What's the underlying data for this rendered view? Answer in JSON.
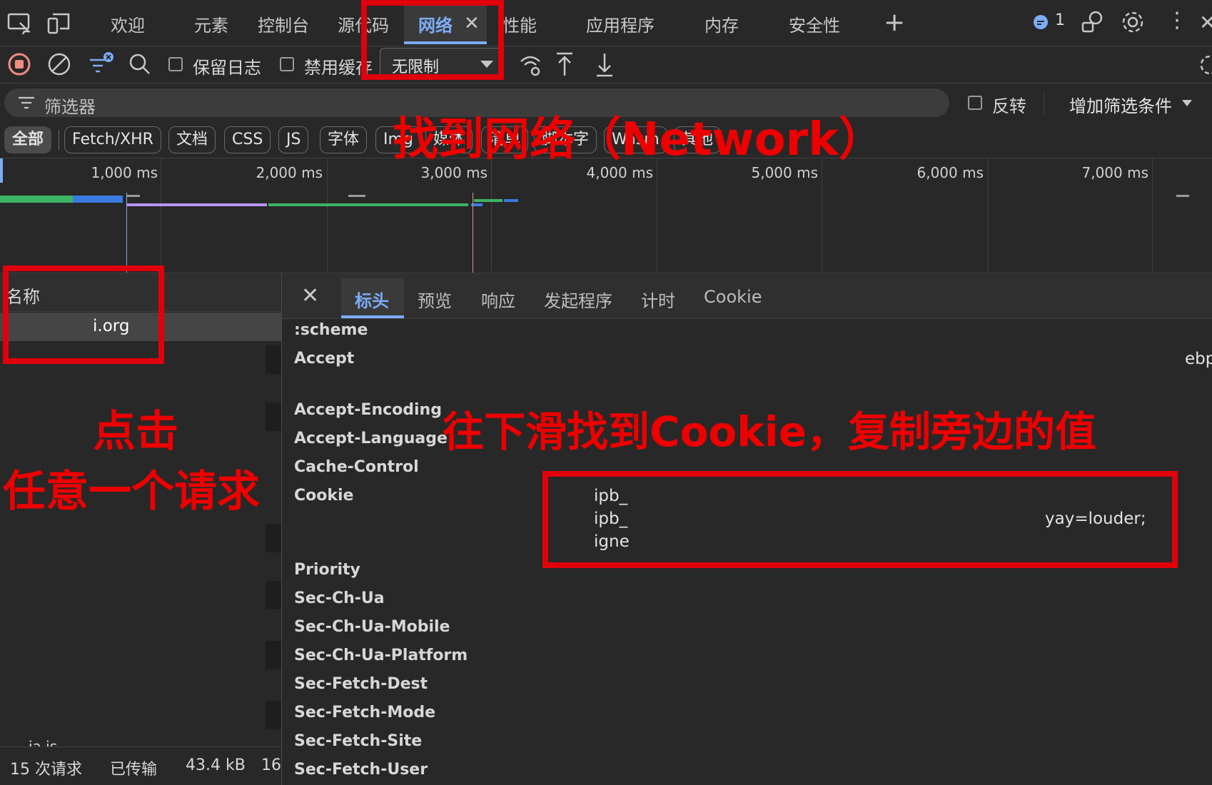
{
  "toolbar_tabs": [
    "欢迎",
    "元素",
    "控制台",
    "源代码",
    "网络",
    "性能",
    "应用程序",
    "内存",
    "安全性"
  ],
  "active_tab": "网络",
  "issues_count": "1",
  "network_bar": {
    "preserve_log": "保留日志",
    "disable_cache": "禁用缓存",
    "throttling": "无限制"
  },
  "filter": {
    "placeholder": "筛选器",
    "invert": "反转",
    "more_filters": "增加筛选条件"
  },
  "type_chips": [
    "全部",
    "Fetch/XHR",
    "文档",
    "CSS",
    "JS",
    "字体",
    "Img",
    "媒体",
    "清单",
    "脚本字",
    "Wasm",
    "其他"
  ],
  "timeline_ticks": [
    "1,000 ms",
    "2,000 ms",
    "3,000 ms",
    "4,000 ms",
    "5,000 ms",
    "6,000 ms",
    "7,000 ms"
  ],
  "requests": {
    "column_name": "名称",
    "selected": "i.org",
    "partial_last": "ia.js"
  },
  "status_bar": {
    "requests": "15 次请求",
    "transferred_label": "已传输",
    "transferred": "43.4 kB",
    "extra": "16"
  },
  "detail_tabs": [
    "标头",
    "预览",
    "响应",
    "发起程序",
    "计时",
    "Cookie"
  ],
  "active_detail_tab": "标头",
  "headers": [
    ":scheme",
    "Accept",
    "Accept-Encoding",
    "Accept-Language",
    "Cache-Control",
    "Cookie",
    "Priority",
    "Sec-Ch-Ua",
    "Sec-Ch-Ua-Mobile",
    "Sec-Ch-Ua-Platform",
    "Sec-Fetch-Dest",
    "Sec-Fetch-Mode",
    "Sec-Fetch-Site",
    "Sec-Fetch-User"
  ],
  "accept_value_fragment": "ebp",
  "cookie_lines": [
    "ipb_",
    "ipb_",
    "igne"
  ],
  "cookie_right_fragment": "yay=louder;",
  "annotations": {
    "find_network": "找到网络（Network）",
    "click_line1": "点击",
    "click_line2": "任意一个请求",
    "scroll_cookie": "往下滑找到Cookie，复制旁边的值"
  },
  "colors": {
    "background": "#282828",
    "accent": "#7cacf8",
    "annotation_red": "#ee0000"
  }
}
